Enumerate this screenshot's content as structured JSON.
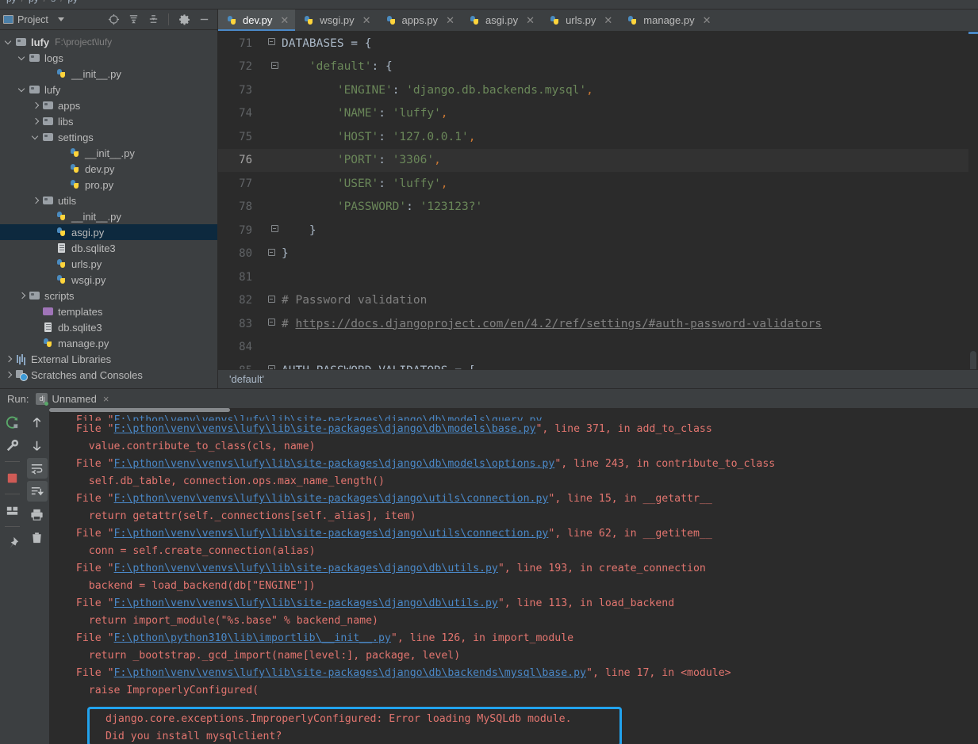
{
  "window": {
    "top_breadcrumb": [
      "py",
      "py",
      "s",
      "py"
    ]
  },
  "project_panel": {
    "title": "Project",
    "title_icon": "project-window-icon",
    "toolbar_icons": [
      "locate-icon",
      "expand-all-icon",
      "collapse-all-icon",
      "gear-icon",
      "minimize-icon"
    ],
    "tree": [
      {
        "label": "lufy",
        "path": "F:\\project\\lufy",
        "icon": "folder",
        "indent": 0,
        "arrow": "d",
        "bold": true,
        "selected": false
      },
      {
        "label": "logs",
        "path": "",
        "icon": "folder",
        "indent": 1,
        "arrow": "d",
        "bold": false,
        "selected": false
      },
      {
        "label": "__init__.py",
        "path": "",
        "icon": "py",
        "indent": 3,
        "arrow": "",
        "bold": false,
        "selected": false
      },
      {
        "label": "lufy",
        "path": "",
        "icon": "folder",
        "indent": 1,
        "arrow": "d",
        "bold": false,
        "selected": false
      },
      {
        "label": "apps",
        "path": "",
        "icon": "folder",
        "indent": 2,
        "arrow": "r",
        "bold": false,
        "selected": false
      },
      {
        "label": "libs",
        "path": "",
        "icon": "folder",
        "indent": 2,
        "arrow": "r",
        "bold": false,
        "selected": false
      },
      {
        "label": "settings",
        "path": "",
        "icon": "folder",
        "indent": 2,
        "arrow": "d",
        "bold": false,
        "selected": false
      },
      {
        "label": "__init__.py",
        "path": "",
        "icon": "py",
        "indent": 4,
        "arrow": "",
        "bold": false,
        "selected": false
      },
      {
        "label": "dev.py",
        "path": "",
        "icon": "py",
        "indent": 4,
        "arrow": "",
        "bold": false,
        "selected": false
      },
      {
        "label": "pro.py",
        "path": "",
        "icon": "py",
        "indent": 4,
        "arrow": "",
        "bold": false,
        "selected": false
      },
      {
        "label": "utils",
        "path": "",
        "icon": "folder",
        "indent": 2,
        "arrow": "r",
        "bold": false,
        "selected": false
      },
      {
        "label": "__init__.py",
        "path": "",
        "icon": "py",
        "indent": 3,
        "arrow": "",
        "bold": false,
        "selected": false
      },
      {
        "label": "asgi.py",
        "path": "",
        "icon": "py",
        "indent": 3,
        "arrow": "",
        "bold": false,
        "selected": true
      },
      {
        "label": "db.sqlite3",
        "path": "",
        "icon": "db",
        "indent": 3,
        "arrow": "",
        "bold": false,
        "selected": false
      },
      {
        "label": "urls.py",
        "path": "",
        "icon": "py",
        "indent": 3,
        "arrow": "",
        "bold": false,
        "selected": false
      },
      {
        "label": "wsgi.py",
        "path": "",
        "icon": "py",
        "indent": 3,
        "arrow": "",
        "bold": false,
        "selected": false
      },
      {
        "label": "scripts",
        "path": "",
        "icon": "folder",
        "indent": 1,
        "arrow": "r",
        "bold": false,
        "selected": false
      },
      {
        "label": "templates",
        "path": "",
        "icon": "folder-t",
        "indent": 2,
        "arrow": "",
        "bold": false,
        "selected": false
      },
      {
        "label": "db.sqlite3",
        "path": "",
        "icon": "db",
        "indent": 2,
        "arrow": "",
        "bold": false,
        "selected": false
      },
      {
        "label": "manage.py",
        "path": "",
        "icon": "py",
        "indent": 2,
        "arrow": "",
        "bold": false,
        "selected": false
      },
      {
        "label": "External Libraries",
        "path": "",
        "icon": "lib",
        "indent": 0,
        "arrow": "r",
        "bold": false,
        "selected": false
      },
      {
        "label": "Scratches and Consoles",
        "path": "",
        "icon": "scr",
        "indent": 0,
        "arrow": "r",
        "bold": false,
        "selected": false
      }
    ]
  },
  "editor": {
    "tabs": [
      {
        "label": "dev.py",
        "active": true
      },
      {
        "label": "wsgi.py",
        "active": false
      },
      {
        "label": "apps.py",
        "active": false
      },
      {
        "label": "asgi.py",
        "active": false
      },
      {
        "label": "urls.py",
        "active": false
      },
      {
        "label": "manage.py",
        "active": false
      }
    ],
    "breadcrumb": "'default'",
    "lines": [
      {
        "no": "71",
        "current": false,
        "fold": "minus",
        "indent": 0,
        "tokens": [
          {
            "t": "DATABASES = {",
            "c": "src"
          }
        ]
      },
      {
        "no": "72",
        "current": false,
        "fold": "minus2",
        "indent": 0,
        "tokens": [
          {
            "t": "    'default'",
            "c": "s-str"
          },
          {
            "t": ": {",
            "c": "src"
          }
        ]
      },
      {
        "no": "73",
        "current": false,
        "fold": "",
        "indent": 1,
        "tokens": [
          {
            "t": "        'ENGINE'",
            "c": "s-str"
          },
          {
            "t": ": ",
            "c": "src"
          },
          {
            "t": "'django.db.backends.mysql'",
            "c": "s-str"
          },
          {
            "t": ",",
            "c": "s-comma"
          }
        ]
      },
      {
        "no": "74",
        "current": false,
        "fold": "",
        "indent": 1,
        "tokens": [
          {
            "t": "        'NAME'",
            "c": "s-str"
          },
          {
            "t": ": ",
            "c": "src"
          },
          {
            "t": "'luffy'",
            "c": "s-str"
          },
          {
            "t": ",",
            "c": "s-comma"
          }
        ]
      },
      {
        "no": "75",
        "current": false,
        "fold": "",
        "indent": 1,
        "tokens": [
          {
            "t": "        'HOST'",
            "c": "s-str"
          },
          {
            "t": ": ",
            "c": "src"
          },
          {
            "t": "'127.0.0.1'",
            "c": "s-str"
          },
          {
            "t": ",",
            "c": "s-comma"
          }
        ]
      },
      {
        "no": "76",
        "current": true,
        "fold": "",
        "indent": 1,
        "tokens": [
          {
            "t": "        'PORT'",
            "c": "s-str"
          },
          {
            "t": ": ",
            "c": "src"
          },
          {
            "t": "'3306'",
            "c": "s-str"
          },
          {
            "t": ",",
            "c": "s-comma"
          }
        ]
      },
      {
        "no": "77",
        "current": false,
        "fold": "",
        "indent": 1,
        "tokens": [
          {
            "t": "        'USER'",
            "c": "s-str"
          },
          {
            "t": ": ",
            "c": "src"
          },
          {
            "t": "'luffy'",
            "c": "s-str"
          },
          {
            "t": ",",
            "c": "s-comma"
          }
        ]
      },
      {
        "no": "78",
        "current": false,
        "fold": "",
        "indent": 1,
        "tokens": [
          {
            "t": "        'PASSWORD'",
            "c": "s-str"
          },
          {
            "t": ": ",
            "c": "src"
          },
          {
            "t": "'123123?'",
            "c": "s-str"
          }
        ]
      },
      {
        "no": "79",
        "current": false,
        "fold": "minus2end",
        "indent": 0,
        "tokens": [
          {
            "t": "    }",
            "c": "src"
          }
        ]
      },
      {
        "no": "80",
        "current": false,
        "fold": "minusend",
        "indent": 0,
        "tokens": [
          {
            "t": "}",
            "c": "src"
          }
        ]
      },
      {
        "no": "81",
        "current": false,
        "fold": "",
        "indent": 0,
        "tokens": []
      },
      {
        "no": "82",
        "current": false,
        "fold": "minus",
        "indent": 0,
        "tokens": [
          {
            "t": "# Password validation",
            "c": "s-cmt"
          }
        ]
      },
      {
        "no": "83",
        "current": false,
        "fold": "minusend",
        "indent": 0,
        "tokens": [
          {
            "t": "# ",
            "c": "s-cmt"
          },
          {
            "t": "https://docs.djangoproject.com/en/4.2/ref/settings/#auth-password-validators",
            "c": "s-link"
          }
        ]
      },
      {
        "no": "84",
        "current": false,
        "fold": "",
        "indent": 0,
        "tokens": []
      },
      {
        "no": "85",
        "current": false,
        "fold": "minus",
        "indent": 0,
        "tokens": [
          {
            "t": "AUTH_PASSWORD_VALIDATORS = [",
            "c": "src"
          }
        ]
      }
    ]
  },
  "run_panel": {
    "run_label": "Run:",
    "tab_label": "Unnamed",
    "tab_icon": "django-run-config-icon",
    "tab_close": "×",
    "tools_left": [
      "rerun-icon",
      "wrench-icon",
      "stop-icon",
      "layout-icon",
      "pin-icon"
    ],
    "tools_right": [
      "arrow-up-icon",
      "arrow-down-icon",
      "soft-wrap-icon",
      "scroll-to-end-icon",
      "print-icon",
      "trash-icon"
    ],
    "console": [
      {
        "cut": true,
        "parts": [
          {
            "t": "  File \"",
            "c": "err"
          },
          {
            "t": "F:\\pthon\\venv\\venvs\\lufy\\lib\\site-packages\\django\\db\\models\\query.py",
            "c": "lnk"
          }
        ]
      },
      {
        "parts": [
          {
            "t": "  File \"",
            "c": "err"
          },
          {
            "t": "F:\\pthon\\venv\\venvs\\lufy\\lib\\site-packages\\django\\db\\models\\base.py",
            "c": "lnk"
          },
          {
            "t": "\", line 371, in add_to_class",
            "c": "err"
          }
        ]
      },
      {
        "parts": [
          {
            "t": "    value.contribute_to_class(cls, name)",
            "c": "err"
          }
        ]
      },
      {
        "parts": [
          {
            "t": "  File \"",
            "c": "err"
          },
          {
            "t": "F:\\pthon\\venv\\venvs\\lufy\\lib\\site-packages\\django\\db\\models\\options.py",
            "c": "lnk"
          },
          {
            "t": "\", line 243, in contribute_to_class",
            "c": "err"
          }
        ]
      },
      {
        "parts": [
          {
            "t": "    self.db_table, connection.ops.max_name_length()",
            "c": "err"
          }
        ]
      },
      {
        "parts": [
          {
            "t": "  File \"",
            "c": "err"
          },
          {
            "t": "F:\\pthon\\venv\\venvs\\lufy\\lib\\site-packages\\django\\utils\\connection.py",
            "c": "lnk"
          },
          {
            "t": "\", line 15, in __getattr__",
            "c": "err"
          }
        ]
      },
      {
        "parts": [
          {
            "t": "    return getattr(self._connections[self._alias], item)",
            "c": "err"
          }
        ]
      },
      {
        "parts": [
          {
            "t": "  File \"",
            "c": "err"
          },
          {
            "t": "F:\\pthon\\venv\\venvs\\lufy\\lib\\site-packages\\django\\utils\\connection.py",
            "c": "lnk"
          },
          {
            "t": "\", line 62, in __getitem__",
            "c": "err"
          }
        ]
      },
      {
        "parts": [
          {
            "t": "    conn = self.create_connection(alias)",
            "c": "err"
          }
        ]
      },
      {
        "parts": [
          {
            "t": "  File \"",
            "c": "err"
          },
          {
            "t": "F:\\pthon\\venv\\venvs\\lufy\\lib\\site-packages\\django\\db\\utils.py",
            "c": "lnk"
          },
          {
            "t": "\", line 193, in create_connection",
            "c": "err"
          }
        ]
      },
      {
        "parts": [
          {
            "t": "    backend = load_backend(db[\"ENGINE\"])",
            "c": "err"
          }
        ]
      },
      {
        "parts": [
          {
            "t": "  File \"",
            "c": "err"
          },
          {
            "t": "F:\\pthon\\venv\\venvs\\lufy\\lib\\site-packages\\django\\db\\utils.py",
            "c": "lnk"
          },
          {
            "t": "\", line 113, in load_backend",
            "c": "err"
          }
        ]
      },
      {
        "parts": [
          {
            "t": "    return import_module(\"%s.base\" % backend_name)",
            "c": "err"
          }
        ]
      },
      {
        "parts": [
          {
            "t": "  File \"",
            "c": "err"
          },
          {
            "t": "F:\\pthon\\python310\\lib\\importlib\\__init__.py",
            "c": "lnk"
          },
          {
            "t": "\", line 126, in import_module",
            "c": "err"
          }
        ]
      },
      {
        "parts": [
          {
            "t": "    return _bootstrap._gcd_import(name[level:], package, level)",
            "c": "err"
          }
        ]
      },
      {
        "parts": [
          {
            "t": "  File \"",
            "c": "err"
          },
          {
            "t": "F:\\pthon\\venv\\venvs\\lufy\\lib\\site-packages\\django\\db\\backends\\mysql\\base.py",
            "c": "lnk"
          },
          {
            "t": "\", line 17, in <module>",
            "c": "err"
          }
        ]
      },
      {
        "parts": [
          {
            "t": "    raise ImproperlyConfigured(",
            "c": "err"
          }
        ]
      }
    ],
    "error_box": {
      "border_color": "#22a3ee",
      "lines": [
        "django.core.exceptions.ImproperlyConfigured: Error loading MySQLdb module.",
        "Did you install mysqlclient?"
      ]
    }
  }
}
